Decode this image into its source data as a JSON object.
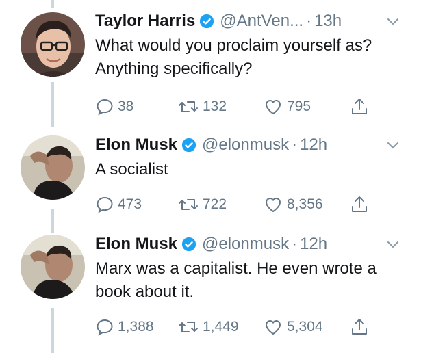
{
  "tweets": [
    {
      "name": "Taylor Harris",
      "handle": "@AntVen...",
      "dot": "·",
      "time": "13h",
      "text": "What would you proclaim yourself as? Anything specifically?",
      "replies": "38",
      "retweets": "132",
      "likes": "795",
      "avatar": "person-with-glasses",
      "verified": true
    },
    {
      "name": "Elon Musk",
      "handle": "@elonmusk",
      "dot": "·",
      "time": "12h",
      "text": "A socialist",
      "replies": "473",
      "retweets": "722",
      "likes": "8,356",
      "avatar": "elon-profile-photo",
      "verified": true
    },
    {
      "name": "Elon Musk",
      "handle": "@elonmusk",
      "dot": "·",
      "time": "12h",
      "text": "Marx was a capitalist. He even wrote a book about it.",
      "replies": "1,388",
      "retweets": "1,449",
      "likes": "5,304",
      "avatar": "elon-profile-photo",
      "verified": true
    }
  ],
  "colors": {
    "verified": "#1da1f2",
    "muted": "#657786",
    "thread_line": "#ccd6dd",
    "text": "#14171a"
  }
}
